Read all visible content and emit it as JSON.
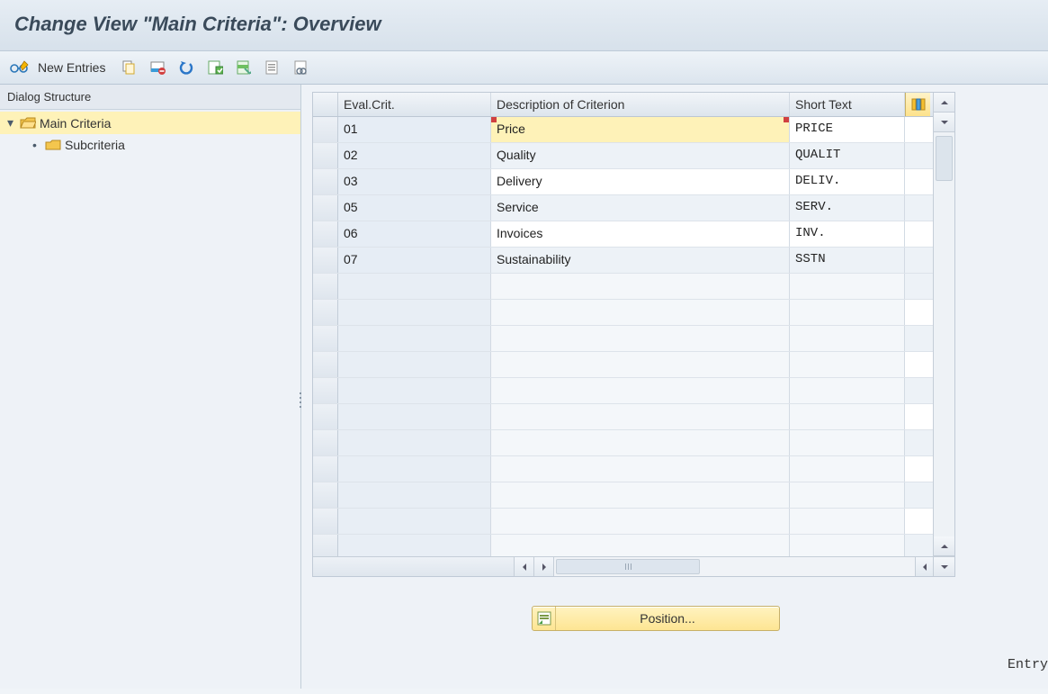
{
  "title": "Change View \"Main Criteria\": Overview",
  "toolbar": {
    "new_entries": "New Entries"
  },
  "sidebar": {
    "header": "Dialog Structure",
    "items": [
      {
        "label": "Main Criteria",
        "selected": true,
        "expanded": true,
        "level": 0
      },
      {
        "label": "Subcriteria",
        "selected": false,
        "expanded": false,
        "level": 1
      }
    ]
  },
  "grid": {
    "columns": {
      "eval": "Eval.Crit.",
      "desc": "Description of Criterion",
      "short": "Short Text"
    },
    "rows": [
      {
        "eval": "01",
        "desc": "Price",
        "short": "PRICE",
        "highlight": true
      },
      {
        "eval": "02",
        "desc": "Quality",
        "short": "QUALIT"
      },
      {
        "eval": "03",
        "desc": "Delivery",
        "short": "DELIV."
      },
      {
        "eval": "05",
        "desc": "Service",
        "short": "SERV."
      },
      {
        "eval": "06",
        "desc": "Invoices",
        "short": "INV."
      },
      {
        "eval": "07",
        "desc": "Sustainability",
        "short": "SSTN"
      }
    ],
    "empty_rows": 11
  },
  "footer": {
    "position_label": "Position...",
    "entry_label": "Entry"
  }
}
